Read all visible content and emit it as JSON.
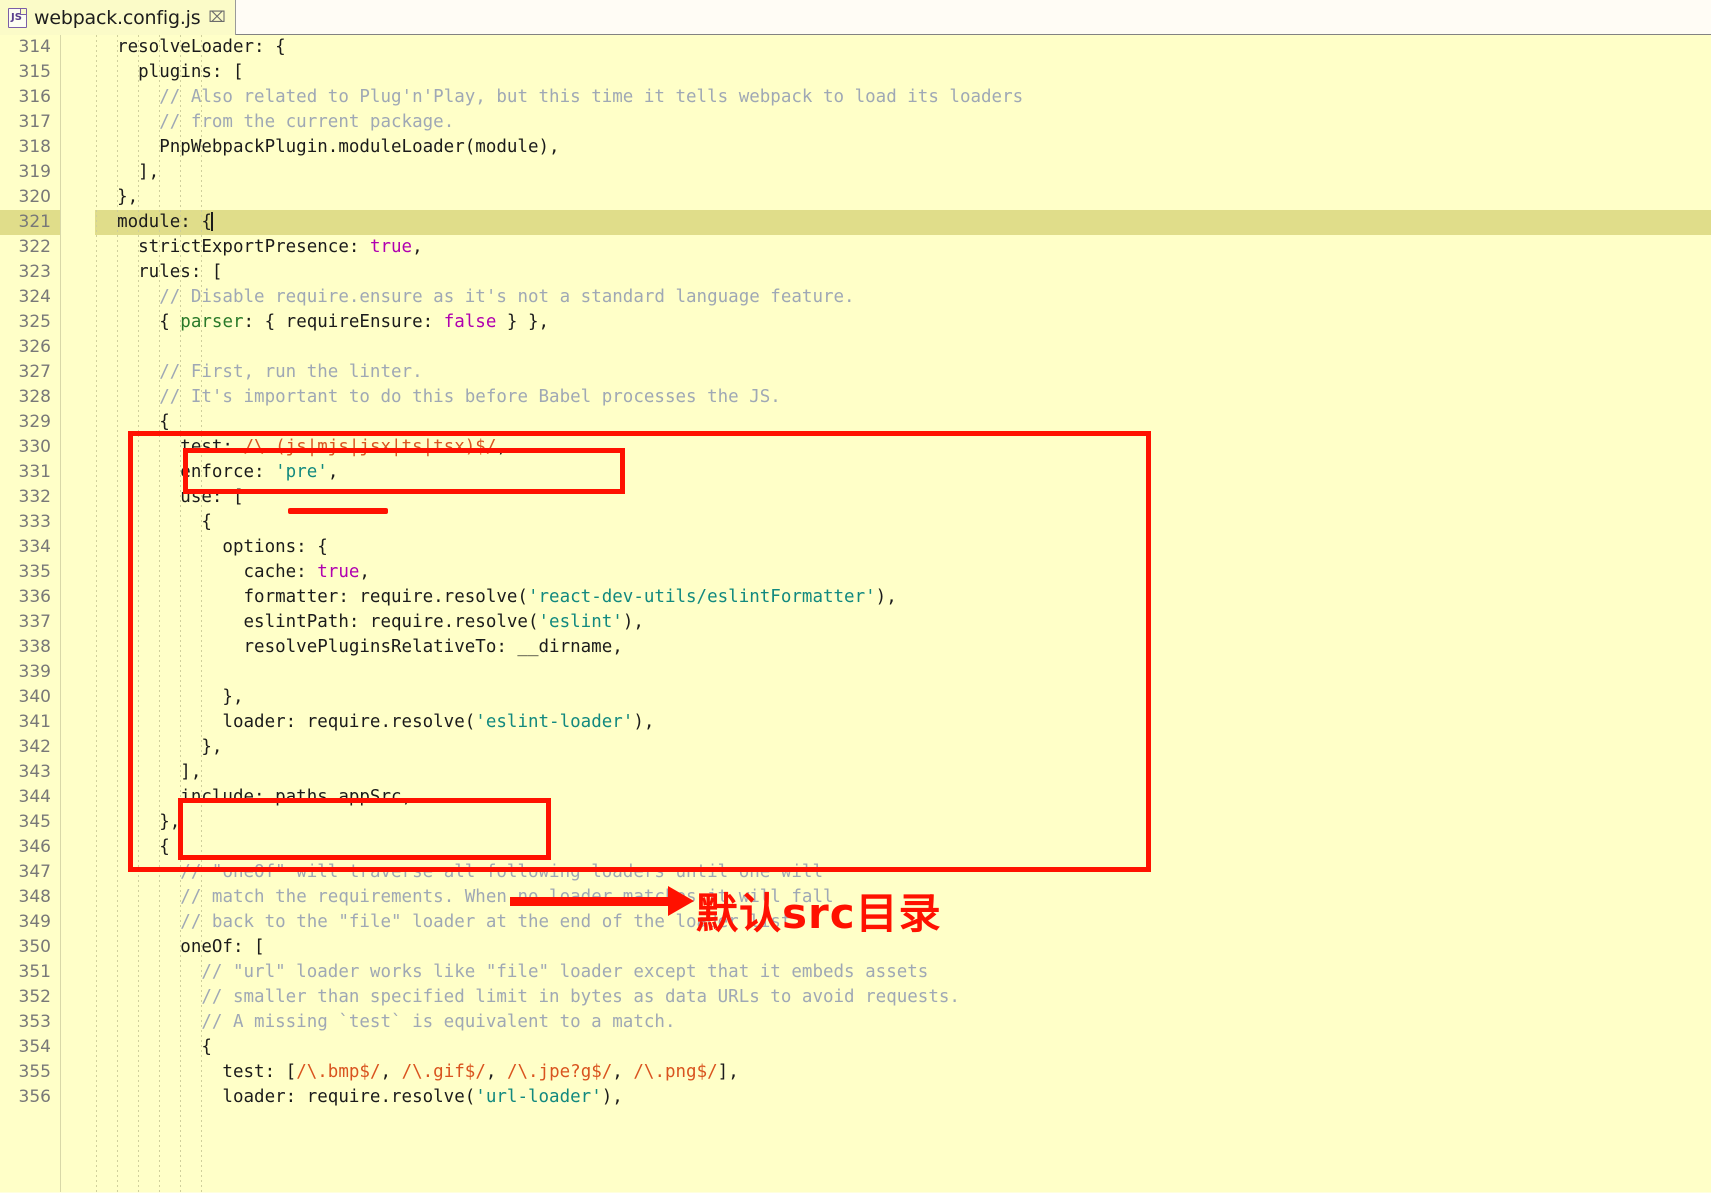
{
  "window": {
    "app": "eclipse-like-code-editor",
    "background_color": "#ffffc8"
  },
  "tab": {
    "icon_label": "JS",
    "title": "webpack.config.js",
    "close_glyph": "⌧"
  },
  "editor": {
    "first_line_number": 314,
    "current_line_number": 321,
    "colors": {
      "background": "#ffffc8",
      "current_line": "#e0dd8a",
      "line_number": "#787878",
      "comment": "#9fa8b5",
      "keyword": "#b000b0",
      "string": "#12897f",
      "regex": "#d9541f",
      "annotation_red": "#ff1100"
    },
    "lines": [
      {
        "n": 314,
        "html": "  resolveLoader: {"
      },
      {
        "n": 315,
        "html": "    plugins: ["
      },
      {
        "n": 316,
        "html": "      <span class=\"c-com\">// Also related to Plug'n'Play, but this time it tells webpack to load its loaders</span>"
      },
      {
        "n": 317,
        "html": "      <span class=\"c-com\">// from the current package.</span>"
      },
      {
        "n": 318,
        "html": "      PnpWebpackPlugin.moduleLoader(module),"
      },
      {
        "n": 319,
        "html": "    ],"
      },
      {
        "n": 320,
        "html": "  },"
      },
      {
        "n": 321,
        "html": "  module: {<span class=\"caret\"></span>"
      },
      {
        "n": 322,
        "html": "    strictExportPresence: <span class=\"c-kw\">true</span>,"
      },
      {
        "n": 323,
        "html": "    rules: ["
      },
      {
        "n": 324,
        "html": "      <span class=\"c-com\">// Disable require.ensure as it's not a standard language feature.</span>"
      },
      {
        "n": 325,
        "html": "      { <span class=\"c-gr\">parser</span>: { requireEnsure: <span class=\"c-kw\">false</span> } },"
      },
      {
        "n": 326,
        "html": ""
      },
      {
        "n": 327,
        "html": "      <span class=\"c-com\">// First, run the linter.</span>"
      },
      {
        "n": 328,
        "html": "      <span class=\"c-com\">// It's important to do this before Babel processes the JS.</span>"
      },
      {
        "n": 329,
        "html": "      {"
      },
      {
        "n": 330,
        "html": "        test: <span class=\"c-re\">/\\.(js|mjs|jsx|ts|tsx)$/</span>,"
      },
      {
        "n": 331,
        "html": "        enforce: <span class=\"c-str\">'pre'</span>,"
      },
      {
        "n": 332,
        "html": "        use: ["
      },
      {
        "n": 333,
        "html": "          {"
      },
      {
        "n": 334,
        "html": "            options: {"
      },
      {
        "n": 335,
        "html": "              cache: <span class=\"c-kw\">true</span>,"
      },
      {
        "n": 336,
        "html": "              formatter: require.resolve(<span class=\"c-str\">'react-dev-utils/eslintFormatter'</span>),"
      },
      {
        "n": 337,
        "html": "              eslintPath: require.resolve(<span class=\"c-str\">'eslint'</span>),"
      },
      {
        "n": 338,
        "html": "              resolvePluginsRelativeTo: __dirname,"
      },
      {
        "n": 339,
        "html": ""
      },
      {
        "n": 340,
        "html": "            },"
      },
      {
        "n": 341,
        "html": "            loader: require.resolve(<span class=\"c-str\">'eslint-loader'</span>),"
      },
      {
        "n": 342,
        "html": "          },"
      },
      {
        "n": 343,
        "html": "        ],"
      },
      {
        "n": 344,
        "html": "        include: paths.appSrc,"
      },
      {
        "n": 345,
        "html": "      },"
      },
      {
        "n": 346,
        "html": "      {"
      },
      {
        "n": 347,
        "html": "        <span class=\"c-com\">// \"oneOf\" will traverse all following loaders until one will</span>"
      },
      {
        "n": 348,
        "html": "        <span class=\"c-com\">// match the requirements. When no loader matches it will fall</span>"
      },
      {
        "n": 349,
        "html": "        <span class=\"c-com\">// back to the \"file\" loader at the end of the loader list.</span>"
      },
      {
        "n": 350,
        "html": "        oneOf: ["
      },
      {
        "n": 351,
        "html": "          <span class=\"c-com\">// \"url\" loader works like \"file\" loader except that it embeds assets</span>"
      },
      {
        "n": 352,
        "html": "          <span class=\"c-com\">// smaller than specified limit in bytes as data URLs to avoid requests.</span>"
      },
      {
        "n": 353,
        "html": "          <span class=\"c-com\">// A missing `test` is equivalent to a match.</span>"
      },
      {
        "n": 354,
        "html": "          {"
      },
      {
        "n": 355,
        "html": "            test: [<span class=\"c-re\">/\\.bmp$/</span>, <span class=\"c-re\">/\\.gif$/</span>, <span class=\"c-re\">/\\.jpe?g$/</span>, <span class=\"c-re\">/\\.png$/</span>],"
      },
      {
        "n": 356,
        "html": "            loader: require.resolve(<span class=\"c-str\">'url-loader'</span>),"
      }
    ]
  },
  "annotations": {
    "note_text": "默认src目录",
    "outer_box_label": "eslint-rule-outer-highlight",
    "test_box_label": "test-regex-highlight",
    "include_box_label": "include-appsrc-highlight",
    "pre_underline_label": "enforce-pre-underline",
    "color": "#ff1100"
  }
}
